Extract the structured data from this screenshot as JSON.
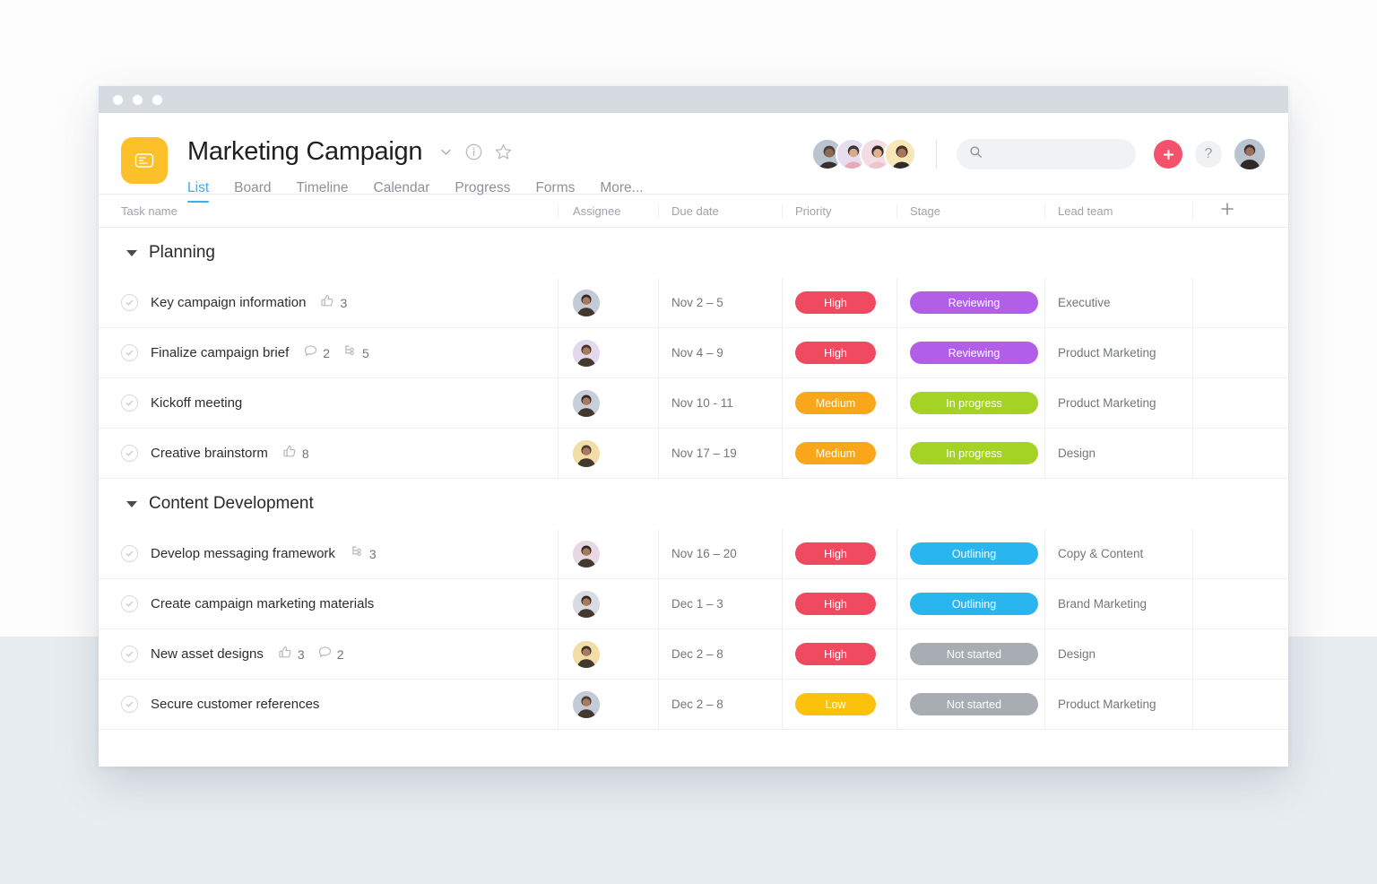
{
  "window": {
    "titlebar_dots": 3
  },
  "header": {
    "project_title": "Marketing Campaign",
    "logo_icon": "project-card-icon",
    "caret_icon": "chevron-down-icon",
    "info_icon": "info-circle-icon",
    "star_icon": "star-icon",
    "tabs": [
      {
        "label": "List",
        "active": true
      },
      {
        "label": "Board",
        "active": false
      },
      {
        "label": "Timeline",
        "active": false
      },
      {
        "label": "Calendar",
        "active": false
      },
      {
        "label": "Progress",
        "active": false
      },
      {
        "label": "Forms",
        "active": false
      },
      {
        "label": "More...",
        "active": false
      }
    ],
    "members": [
      {
        "name": "member-avatar-1",
        "color": "#c3ccd6"
      },
      {
        "name": "member-avatar-2",
        "color": "#e4d9ec"
      },
      {
        "name": "member-avatar-3",
        "color": "#f2d9de"
      },
      {
        "name": "member-avatar-4",
        "color": "#f6e3b4"
      }
    ],
    "search": {
      "value": "",
      "placeholder": "",
      "icon": "search-icon"
    },
    "add_button": {
      "label": "+",
      "icon": "plus-icon",
      "color": "#f4516d"
    },
    "help_button": {
      "label": "?",
      "icon": "question-mark-icon"
    },
    "me_avatar": {
      "name": "current-user-avatar",
      "color": "#c3ccd6"
    }
  },
  "table": {
    "columns": [
      {
        "key": "task",
        "label": "Task name"
      },
      {
        "key": "assignee",
        "label": "Assignee"
      },
      {
        "key": "due",
        "label": "Due date"
      },
      {
        "key": "priority",
        "label": "Priority"
      },
      {
        "key": "stage",
        "label": "Stage"
      },
      {
        "key": "team",
        "label": "Lead team"
      }
    ],
    "add_column_icon": "plus-icon",
    "colors": {
      "priority_high": "#ef4a5f",
      "priority_medium": "#f9a61b",
      "priority_low": "#fcc10c",
      "stage_reviewing": "#b15ee8",
      "stage_in_progress": "#a4d326",
      "stage_outlining": "#29b6f0",
      "stage_not_started": "#a7adb2"
    },
    "groups": [
      {
        "title": "Planning",
        "expanded": true,
        "rows": [
          {
            "task": "Key campaign information",
            "badges": [
              {
                "icon": "thumbs-up-icon",
                "count": "3"
              }
            ],
            "avatar_color": "#c3ccd6",
            "due": "Nov 2 – 5",
            "priority": "High",
            "priority_color": "#ef4a5f",
            "stage": "Reviewing",
            "stage_color": "#b15ee8",
            "team": "Executive"
          },
          {
            "task": "Finalize campaign brief",
            "badges": [
              {
                "icon": "comment-icon",
                "count": "2"
              },
              {
                "icon": "subtask-icon",
                "count": "5"
              }
            ],
            "avatar_color": "#e4d9ec",
            "due": "Nov 4 – 9",
            "priority": "High",
            "priority_color": "#ef4a5f",
            "stage": "Reviewing",
            "stage_color": "#b15ee8",
            "team": "Product Marketing"
          },
          {
            "task": "Kickoff meeting",
            "badges": [],
            "avatar_color": "#c7d0d9",
            "due": "Nov 10 - 11",
            "priority": "Medium",
            "priority_color": "#f9a61b",
            "stage": "In progress",
            "stage_color": "#a4d326",
            "team": "Product Marketing"
          },
          {
            "task": "Creative brainstorm",
            "badges": [
              {
                "icon": "thumbs-up-icon",
                "count": "8"
              }
            ],
            "avatar_color": "#f3dda6",
            "due": "Nov 17 – 19",
            "priority": "Medium",
            "priority_color": "#f9a61b",
            "stage": "In progress",
            "stage_color": "#a4d326",
            "team": "Design"
          }
        ]
      },
      {
        "title": "Content Development",
        "expanded": true,
        "rows": [
          {
            "task": "Develop messaging framework",
            "badges": [
              {
                "icon": "subtask-icon",
                "count": "3"
              }
            ],
            "avatar_color": "#e8d8e4",
            "due": "Nov 16 – 20",
            "priority": "High",
            "priority_color": "#ef4a5f",
            "stage": "Outlining",
            "stage_color": "#29b6f0",
            "team": "Copy & Content"
          },
          {
            "task": "Create campaign marketing materials",
            "badges": [],
            "avatar_color": "#d6dce2",
            "due": "Dec 1 – 3",
            "priority": "High",
            "priority_color": "#ef4a5f",
            "stage": "Outlining",
            "stage_color": "#29b6f0",
            "team": "Brand Marketing"
          },
          {
            "task": "New asset designs",
            "badges": [
              {
                "icon": "thumbs-up-icon",
                "count": "3"
              },
              {
                "icon": "comment-icon",
                "count": "2"
              }
            ],
            "avatar_color": "#f3dda6",
            "due": "Dec 2 – 8",
            "priority": "High",
            "priority_color": "#ef4a5f",
            "stage": "Not started",
            "stage_color": "#a7adb2",
            "team": "Design"
          },
          {
            "task": "Secure customer references",
            "badges": [],
            "avatar_color": "#c3ccd6",
            "due": "Dec 2 – 8",
            "priority": "Low",
            "priority_color": "#fcc10c",
            "stage": "Not started",
            "stage_color": "#a7adb2",
            "team": "Product Marketing"
          }
        ]
      }
    ]
  }
}
